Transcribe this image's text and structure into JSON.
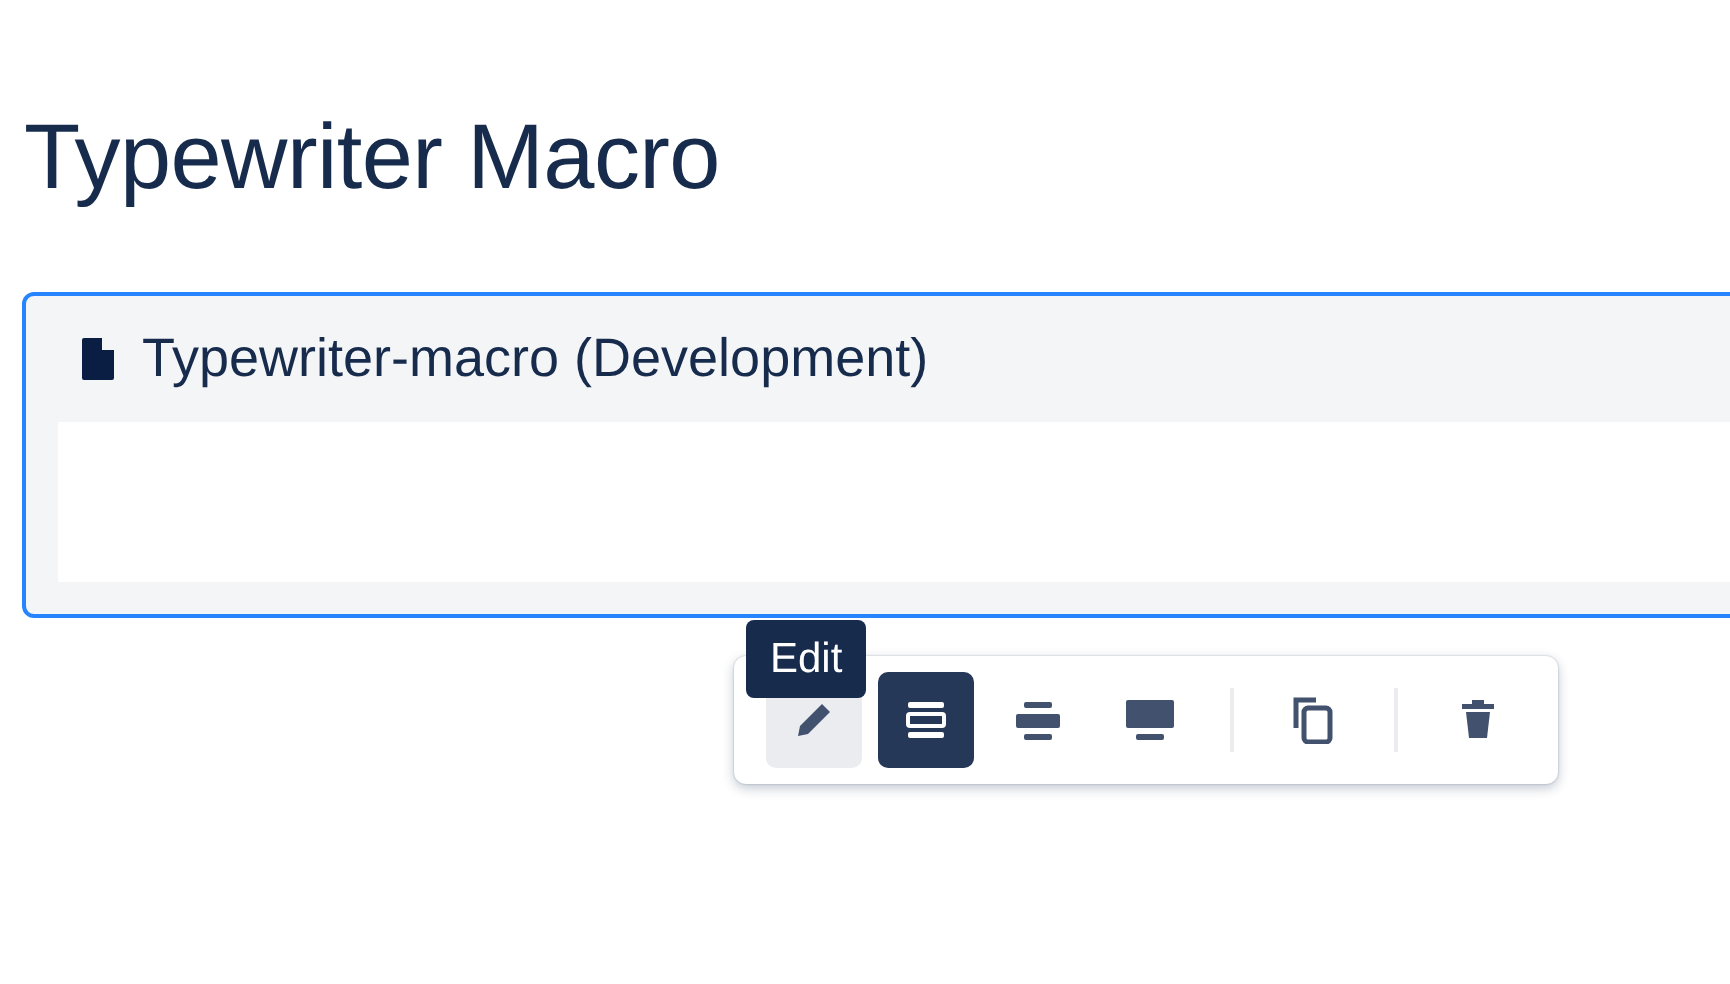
{
  "page": {
    "title": "Typewriter Macro"
  },
  "macro": {
    "title": "Typewriter-macro (Development)",
    "selected": true
  },
  "tooltip": {
    "text": "Edit"
  },
  "toolbar": [
    {
      "kind": "edit",
      "hovered": true,
      "selected": false
    },
    {
      "kind": "layout-narrow",
      "selected": true
    },
    {
      "kind": "layout-wide",
      "selected": false
    },
    {
      "kind": "layout-full",
      "selected": false
    },
    {
      "kind": "separator"
    },
    {
      "kind": "copy",
      "selected": false
    },
    {
      "kind": "separator"
    },
    {
      "kind": "delete",
      "selected": false
    }
  ]
}
